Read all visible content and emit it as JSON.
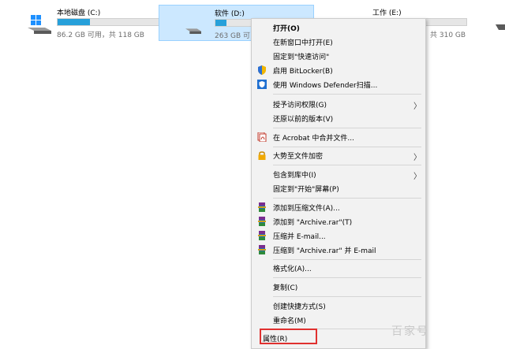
{
  "drives": [
    {
      "name": "本地磁盘 (C:)",
      "size_text": "86.2 GB 可用，共 118 GB",
      "fill": 0.27
    },
    {
      "name": "软件 (D:)",
      "size_text": "263 GB 可",
      "fill": 0.12
    },
    {
      "name": "工作 (E:)",
      "size_text": "，共 310 GB",
      "fill": 0.1
    }
  ],
  "menu": {
    "items": [
      {
        "label": "打开(O)"
      },
      {
        "label": "在新窗口中打开(E)"
      },
      {
        "label": "固定到\"快速访问\""
      },
      {
        "label": "启用 BitLocker(B)",
        "icon": "shield-icon"
      },
      {
        "label": "使用 Windows Defender扫描...",
        "icon": "defender-icon"
      },
      {
        "label": "授予访问权限(G)"
      },
      {
        "label": "还原以前的版本(V)"
      },
      {
        "label": "在 Acrobat 中合并文件...",
        "icon": "acrobat-icon"
      },
      {
        "label": "大势至文件加密",
        "icon": "lock-icon"
      },
      {
        "label": "包含到库中(I)"
      },
      {
        "label": "固定到\"开始\"屏幕(P)"
      },
      {
        "label": "添加到压缩文件(A)...",
        "icon": "winrar-icon"
      },
      {
        "label": "添加到 \"Archive.rar\"(T)",
        "icon": "winrar-icon"
      },
      {
        "label": "压缩并 E-mail...",
        "icon": "winrar-icon"
      },
      {
        "label": "压缩到 \"Archive.rar\" 并 E-mail",
        "icon": "winrar-icon"
      },
      {
        "label": "格式化(A)..."
      },
      {
        "label": "复制(C)"
      },
      {
        "label": "创建快捷方式(S)"
      },
      {
        "label": "重命名(M)"
      },
      {
        "label": "属性(R)"
      }
    ],
    "submenu_arrow": "〉"
  },
  "watermark": "百家号"
}
